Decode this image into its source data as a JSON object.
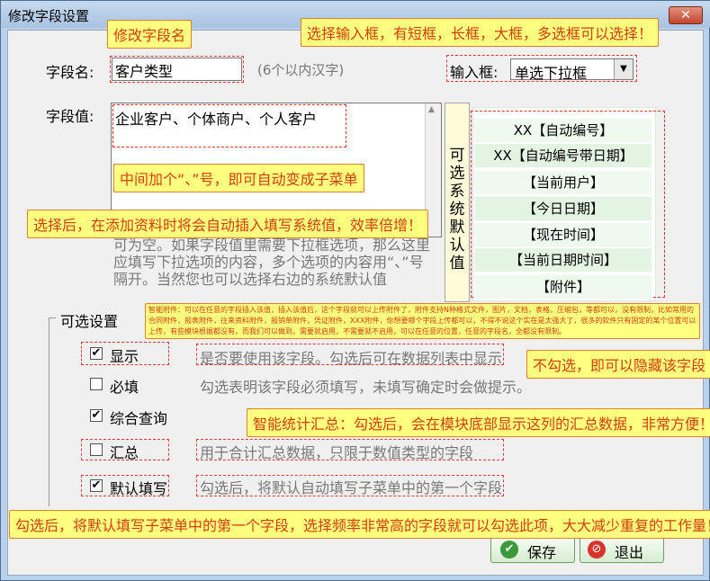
{
  "window": {
    "title": "修改字段设置",
    "close_glyph": "✕"
  },
  "field_name": {
    "label": "字段名:",
    "value": "客户类型",
    "hint": "(6个以内汉字)"
  },
  "input_type": {
    "label": "输入框:",
    "value": "单选下拉框"
  },
  "field_value": {
    "label": "字段值:",
    "value": "企业客户、个体商户、个人客户",
    "help_text": "可为空。如果字段值里需要下拉框选项，那么这里应填写下拉选项的内容，多个选项的内容用“、”号隔开。当然您也可以选择右边的系统默认值"
  },
  "system_defaults": {
    "vertical_label": "可选系统默认值",
    "items": [
      "XX【自动编号】",
      "XX【自动编号带日期】",
      "【当前用户】",
      "【今日日期】",
      "【现在时间】",
      "【当前日期时间】",
      "【附件】"
    ]
  },
  "options": {
    "group_label": "可选设置",
    "items": [
      {
        "label": "显示",
        "checked": true,
        "description": "是否要使用该字段。勾选后可在数据列表中显示"
      },
      {
        "label": "必填",
        "checked": false,
        "description": "勾选表明该字段必须填写，未填写确定时会做提示。"
      },
      {
        "label": "综合查询",
        "checked": true,
        "description": ""
      },
      {
        "label": "汇总",
        "checked": false,
        "description": "用于合计汇总数据，只限于数值类型的字段"
      },
      {
        "label": "默认填写",
        "checked": true,
        "description": "勾选后，将默认自动填写子菜单中的第一个字段"
      }
    ]
  },
  "buttons": {
    "save": "保存",
    "exit": "退出"
  },
  "callouts": {
    "rename": "修改字段名",
    "input_types": "选择输入框，有短框，长框，大框，多选框可以选择！",
    "separator": "中间加个“、”号，即可自动变成子菜单",
    "system_value": "选择后，在添加资料时将会自动插入填写系统值，效率倍增！",
    "attachment": "智能附件：可以在任意的字段插入该值，插入该值后，这个字段就可以上传附件了，附件支持N种格式文件，图片，文档，表格，压缩包，等都可以，没有限制，比如常用的合同附件，报表附件，往来资料附件，报销单附件，凭证附件，XXX附件，你想要哪个字段上传都可以，不得不说这个实在是太强大了，很多的软件只有固定的某个位置可以上传，有些模块根据都没有，而我们可以做到，需要就启用，不需要就不启用，可以在任意的位置，任意的字段名，全都没有限制。",
    "hide": "不勾选，即可以隐藏该字段",
    "summary": "智能统计汇总：勾选后，会在模块底部显示这列的汇总数据，非常方便！",
    "default_fill": "勾选后，将默认填写子菜单中的第一个字段，选择频率非常高的字段就可以勾选此项，大大减少重复的工作量！"
  }
}
